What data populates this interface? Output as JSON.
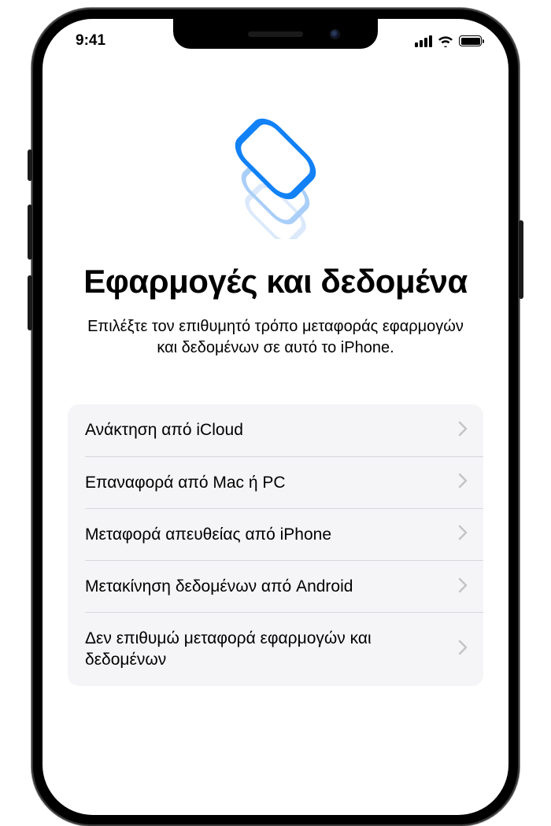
{
  "status": {
    "time": "9:41"
  },
  "title": "Εφαρμογές και δεδομένα",
  "subtitle": "Επιλέξτε τον επιθυμητό τρόπο μεταφοράς εφαρμογών και δεδομένων σε αυτό το iPhone.",
  "options": [
    {
      "label": "Ανάκτηση από iCloud"
    },
    {
      "label": "Επαναφορά από Mac ή PC"
    },
    {
      "label": "Μεταφορά απευθείας από iPhone"
    },
    {
      "label": "Μετακίνηση δεδομένων από Android"
    },
    {
      "label": "Δεν επιθυμώ μεταφορά εφαρμογών και δεδομένων"
    }
  ]
}
